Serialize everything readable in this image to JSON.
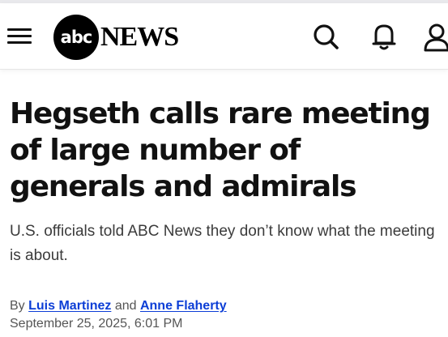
{
  "header": {
    "logo_mark": "abc",
    "logo_word": "NEWS"
  },
  "article": {
    "headline": "Hegseth calls rare meeting of large number of generals and admirals",
    "subhead": "U.S. officials told ABC News they don’t know what the meeting is about.",
    "byline_prefix": "By",
    "author_1": "Luis Martinez",
    "byline_join": "and",
    "author_2": "Anne Flaherty",
    "timestamp": "September 25, 2025, 6:01 PM"
  },
  "icons": {
    "menu": "hamburger-menu-icon",
    "search": "search-icon",
    "notifications": "bell-icon",
    "account": "user-icon"
  },
  "colors": {
    "link": "#0c3ed6",
    "text": "#111111",
    "logo_bg": "#000000"
  }
}
